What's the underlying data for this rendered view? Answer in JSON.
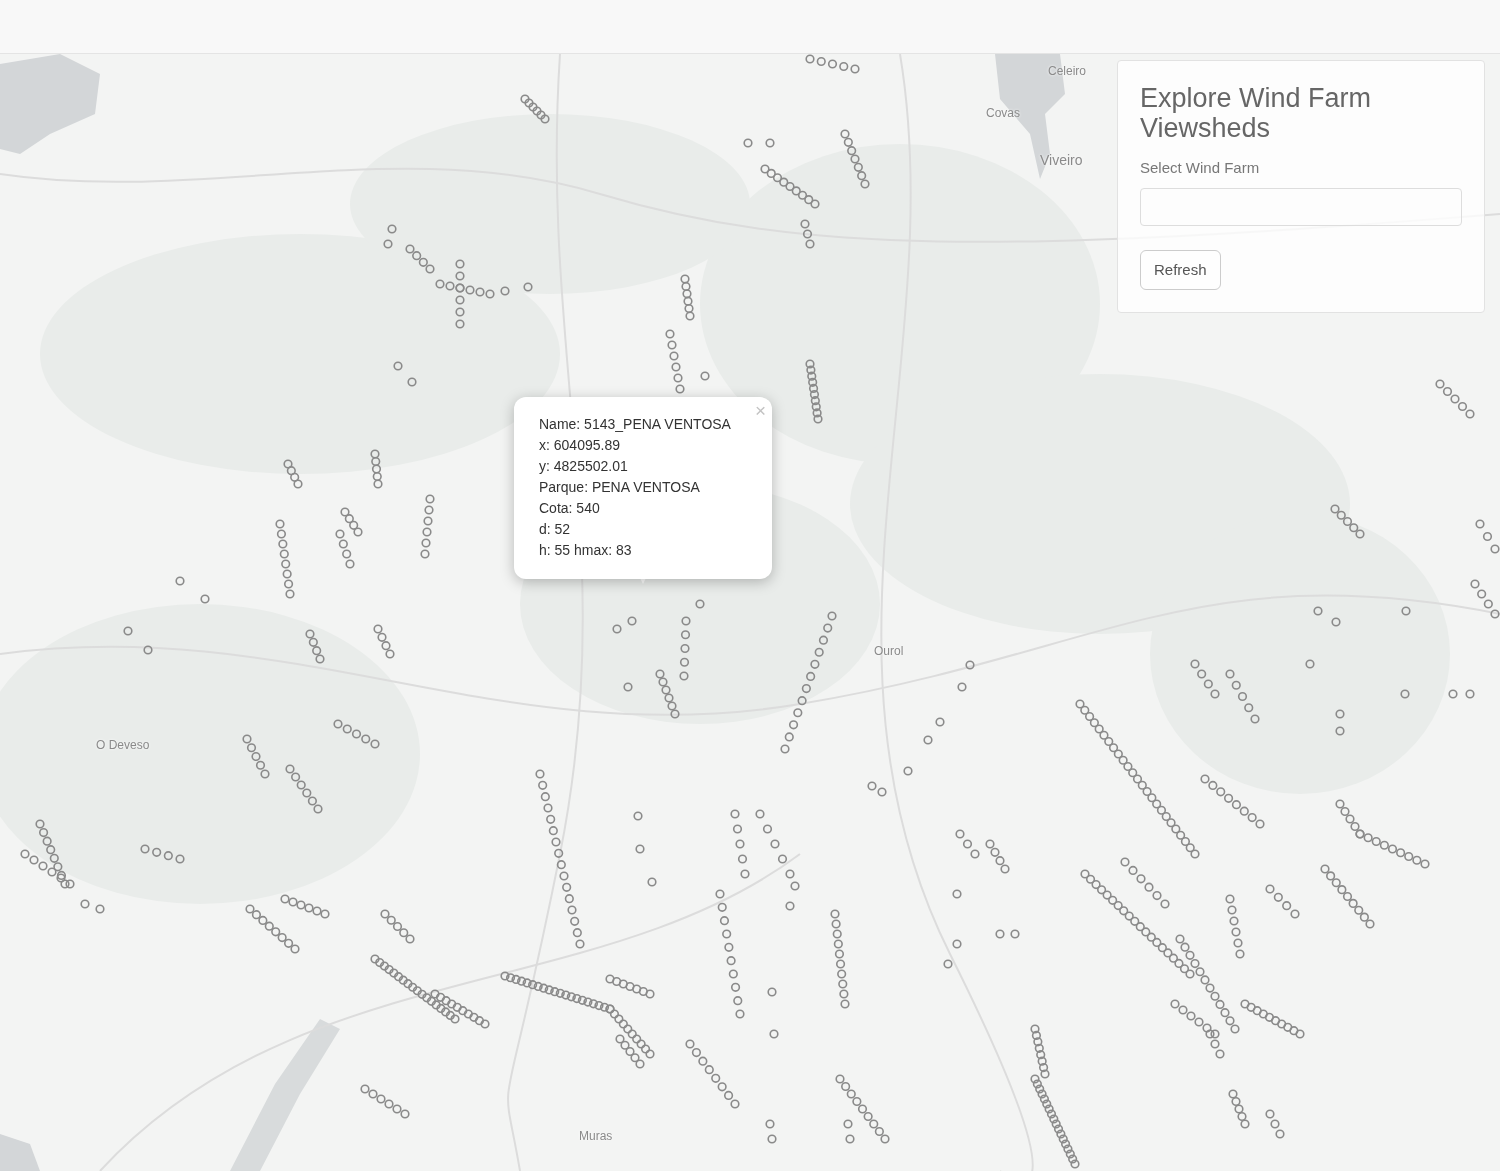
{
  "map": {
    "place_labels": [
      {
        "text": "Celeiro"
      },
      {
        "text": "Covas"
      },
      {
        "text": "Viveiro"
      },
      {
        "text": "Ourol"
      },
      {
        "text": "O Deveso"
      },
      {
        "text": "Muras"
      }
    ]
  },
  "control_panel": {
    "title": "Explore Wind Farm Viewsheds",
    "select_label": "Select Wind Farm",
    "button": "Refresh"
  },
  "popup": {
    "close": "×",
    "lines": [
      "Name: 5143_PENA VENTOSA",
      "x: 604095.89",
      "y: 4825502.01",
      "Parque: PENA VENTOSA",
      "Cota: 540",
      "d: 52",
      "h: 55 hmax: 83"
    ]
  }
}
